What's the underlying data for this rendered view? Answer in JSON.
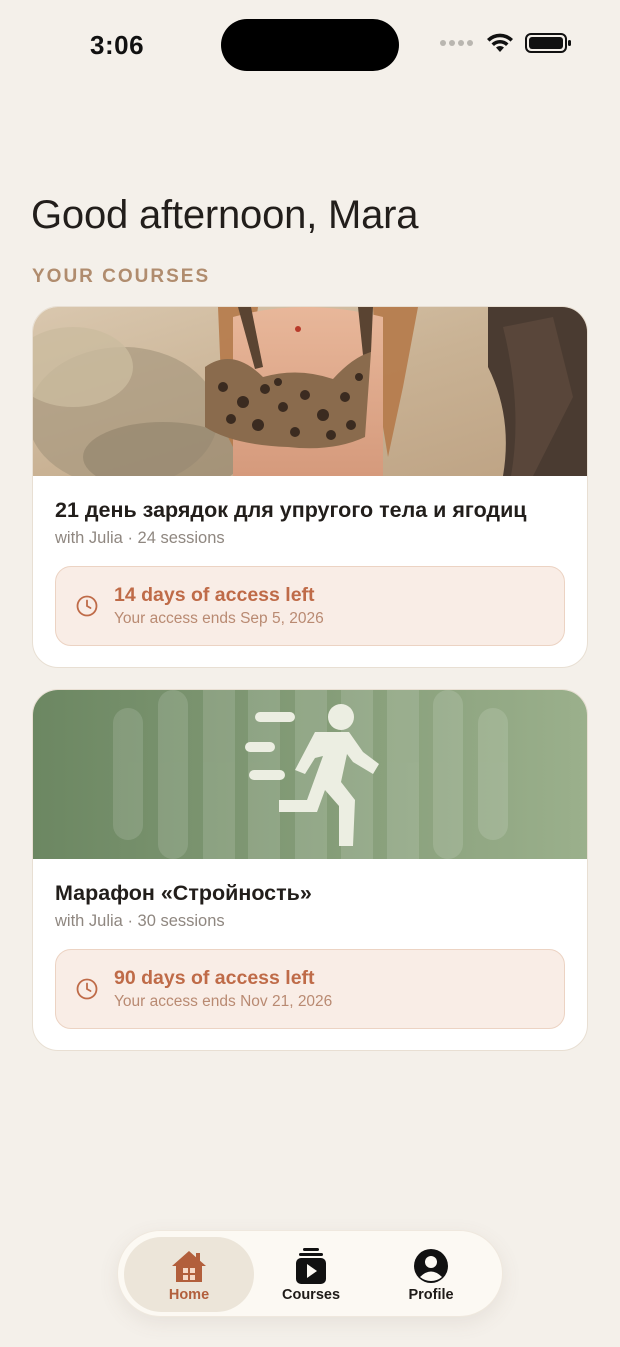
{
  "status_bar": {
    "time": "3:06"
  },
  "greeting": "Good afternoon, Mara",
  "section_label": "YOUR COURSES",
  "courses": [
    {
      "title": "21 день зарядок для упругого тела и ягодиц",
      "meta": "with Julia · 24 sessions",
      "access_left": "14 days of access left",
      "access_ends": "Your access ends Sep 5, 2026"
    },
    {
      "title": "Марафон «Стройность»",
      "meta": "with Julia · 30 sessions",
      "access_left": "90 days of access left",
      "access_ends": "Your access ends Nov 21, 2026"
    }
  ],
  "nav": {
    "home": "Home",
    "courses": "Courses",
    "profile": "Profile"
  },
  "colors": {
    "background": "#f4f0ea",
    "accent": "#b25f3c",
    "access_box": "#f9ede6",
    "green_banner": "#7f9a73"
  },
  "icons": {
    "clock": "clock-icon",
    "home": "house-icon",
    "courses": "play-book-icon",
    "profile": "user-circle-icon",
    "runner": "running-person-icon"
  }
}
